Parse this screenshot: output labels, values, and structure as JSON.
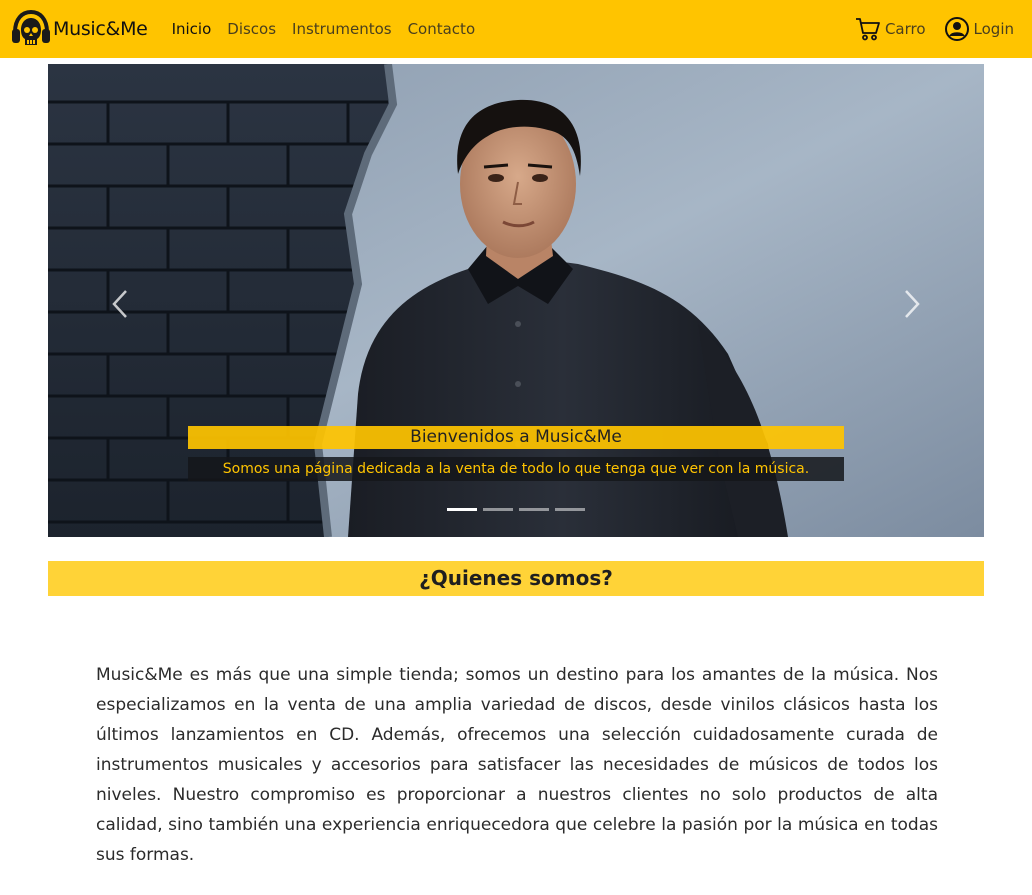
{
  "nav": {
    "brand": "Music&Me",
    "links": [
      {
        "label": "Inicio",
        "active": true
      },
      {
        "label": "Discos",
        "active": false
      },
      {
        "label": "Instrumentos",
        "active": false
      },
      {
        "label": "Contacto",
        "active": false
      }
    ],
    "cart_label": "Carro",
    "login_label": "Login",
    "icons": {
      "brand": "skull-headphones-icon",
      "cart": "cart-icon",
      "login": "user-circle-icon"
    }
  },
  "carousel": {
    "caption_title": "Bienvenidos a Music&Me",
    "caption_text": "Somos una página dedicada a la venta de todo lo que tenga que ver con la música.",
    "slides": 4,
    "active_slide": 1,
    "icons": {
      "prev": "chevron-left-icon",
      "next": "chevron-right-icon"
    }
  },
  "about": {
    "title": "¿Quienes somos?",
    "text": "Music&Me es más que una simple tienda; somos un destino para los amantes de la música. Nos especializamos en la venta de una amplia variedad de discos, desde vinilos clásicos hasta los últimos lanzamientos en CD. Además, ofrecemos una selección cuidadosamente curada de instrumentos musicales y accesorios para satisfacer las necesidades de músicos de todos los niveles. Nuestro compromiso es proporcionar a nuestros clientes no solo productos de alta calidad, sino también una experiencia enriquecedora que celebre la pasión por la música en todas sus formas."
  },
  "colors": {
    "accent": "#ffc400",
    "section_bg": "#ffd337",
    "caption_dark": "#14161a"
  }
}
